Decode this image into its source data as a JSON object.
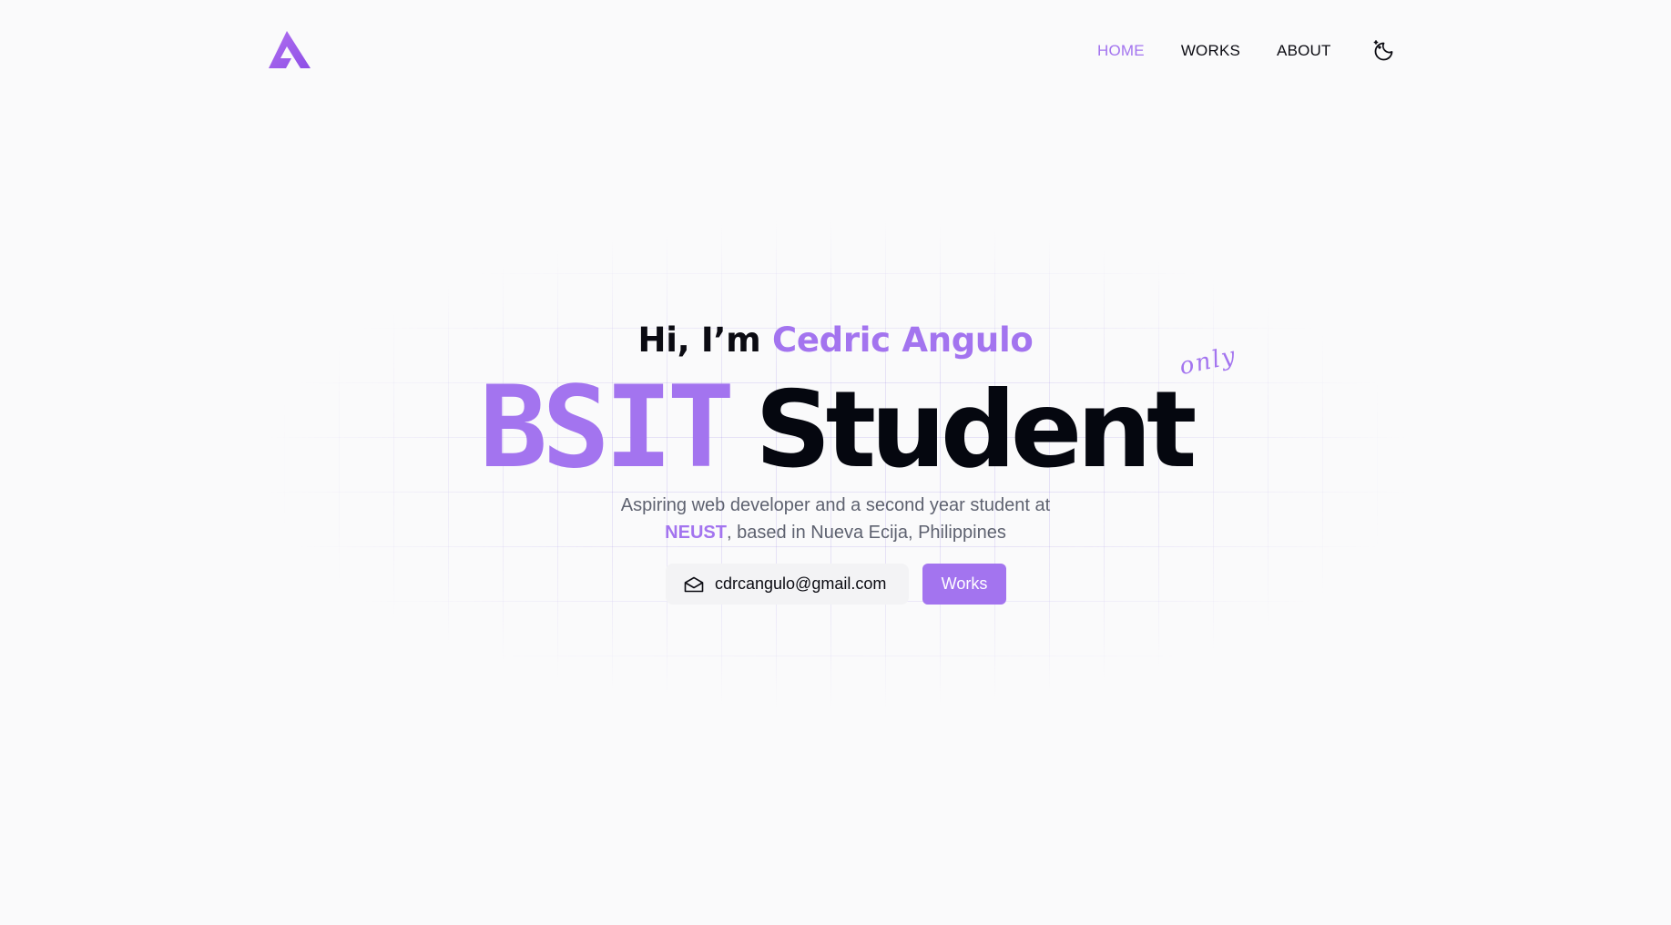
{
  "nav": {
    "logo_icon": "triangle-logo-icon",
    "links": [
      {
        "label": "HOME",
        "active": true
      },
      {
        "label": "WORKS",
        "active": false
      },
      {
        "label": "ABOUT",
        "active": false
      }
    ],
    "theme_toggle_icon": "moon-stars-icon"
  },
  "hero": {
    "greeting_prefix": "Hi, I’m ",
    "name": "Cedric Angulo",
    "headline_accent": "BSIT",
    "headline_main": "Student",
    "annotation": "only",
    "description_line1": "Aspiring web developer and a second year student at",
    "school": "NEUST",
    "description_line2": ", based in Nueva Ecija, Philippines",
    "email": "cdrcangulo@gmail.com",
    "email_icon": "envelope-icon",
    "works_button": "Works"
  },
  "colors": {
    "accent": "#a374ef",
    "text": "#0b0b12",
    "muted": "#5e6270",
    "background": "#fafafb"
  }
}
